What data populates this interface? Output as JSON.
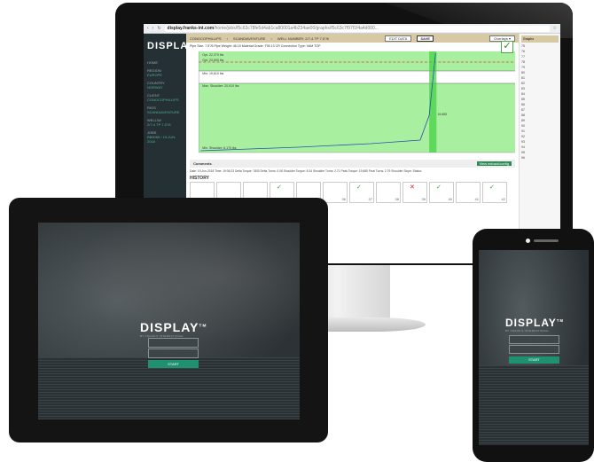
{
  "browser": {
    "url_host": "display.franks-int.com",
    "url_path": "/home/jobs/f5c63c78fe5d4ab1ca80001a4b234ae00/graphs/f5c63c7f97f1f4a4d000..."
  },
  "app": {
    "brand": "DISPLAY",
    "brand_tm": "TM",
    "sidebar": [
      {
        "label": "HOME",
        "value": ""
      },
      {
        "label": "REGION",
        "value": "EUROPE"
      },
      {
        "label": "COUNTRY",
        "value": "NORWAY"
      },
      {
        "label": "CLIENT",
        "value": "CONOCOPHILLIPS"
      },
      {
        "label": "RIGS",
        "value": "SCANDIAVENTURE"
      },
      {
        "label": "WELLS#",
        "value": "2/7-4 TP 7.5\"/6"
      },
      {
        "label": "JOBS",
        "value": "BB6066 / 19-JUN-2018"
      }
    ],
    "breadcrumb": [
      "CONOCOPHILLIPS",
      "SCANDIAVENTURE",
      "WELL NUMBER: 2/7-4 TP 7.5\"/6"
    ],
    "buttons": {
      "edit": "EDIT DATA",
      "save": "SAVE",
      "overlays": "Overlays"
    },
    "specs": "Pipe Size: 7.5\"/6   Pipe Weight: 46.15   Material Grade: T95 13 CR   Connection Type: VAM TOP",
    "chart_labels": [
      "Opt. 22,370 lbs",
      "Opt. 23,500 lbs",
      "Min: 19,610 lbs",
      "Max. Shoulder: 20,910 lbs",
      "Min. Shoulder: 6,170 lbs",
      "19,685"
    ],
    "graphs_header": "Graphs",
    "graphs_rows": [
      "75",
      "76",
      "77",
      "78",
      "79",
      "80",
      "81",
      "82",
      "83",
      "84",
      "85",
      "86",
      "87",
      "88",
      "89",
      "90",
      "91",
      "92",
      "93",
      "94",
      "95",
      "96"
    ],
    "comments_label": "Comments",
    "view_button": "View extract/config",
    "meta": "Date: 19-Jun-2018   Time: 19:06:23   Delta Torque: 7800   Delta Turns: 0.08   Shoulder Torque: 8.34   Shoulder Turns: 2.71   Peak Torque: 19,685   Final Turns: 2.79   Shoulder Slope:   Status:",
    "history_label": "HISTORY",
    "thumbs": [
      {
        "n": "31",
        "mark": ""
      },
      {
        "n": "32",
        "mark": ""
      },
      {
        "n": "33",
        "mark": ""
      },
      {
        "n": "34",
        "mark": "✓"
      },
      {
        "n": "35",
        "mark": ""
      },
      {
        "n": "36",
        "mark": ""
      },
      {
        "n": "37",
        "mark": "✓"
      },
      {
        "n": "38",
        "mark": ""
      },
      {
        "n": "39",
        "mark": "✕"
      },
      {
        "n": "40",
        "mark": "✓"
      },
      {
        "n": "41",
        "mark": ""
      },
      {
        "n": "42",
        "mark": "✓"
      }
    ]
  },
  "login": {
    "brand": "DISPLAY",
    "brand_tm": "TM",
    "tagline": "BY FRANK'S INTERNATIONAL",
    "start_label": "START"
  },
  "colors": {
    "accent": "#1f9070",
    "plot_green": "#a8f0a0",
    "sidebar": "#253035"
  }
}
